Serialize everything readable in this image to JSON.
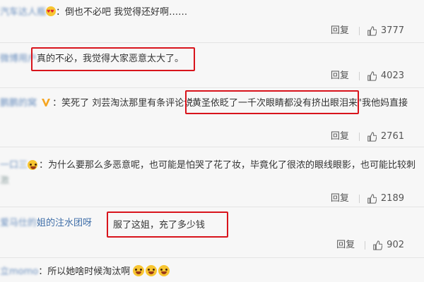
{
  "comments": [
    {
      "user_blurred": "汽车达人瓶",
      "user_suffix": "瓶-",
      "text": "：倒也不必吧 我觉得还好啊……",
      "reply_label": "回复",
      "likes": "3777"
    },
    {
      "user_blurred": "微博用户",
      "text": "真的不必，我觉得大家恶意太大了。",
      "reply_label": "回复",
      "likes": "4023"
    },
    {
      "user_blurred": "鹏鹏的窝",
      "text_before": "：笑死了 刘芸淘汰那里有条评论说",
      "text_highlight": "\"黄圣依眨了一千次眼睛都没有挤出眼泪来\"",
      "text_after": "我他妈直接",
      "reply_label": "回复",
      "likes": "2761"
    },
    {
      "user_blurred": "一口三",
      "text": "：为什么要那么多恶意呢，也可能是怕哭了花了妆，毕竟化了很浓的眼线眼影，也可能比较刺",
      "text_line2_blurred": "激",
      "reply_label": "回复",
      "likes": "2189"
    },
    {
      "user_blurred": "爱马仕的",
      "user_clear": "姐的注水团呀",
      "text": "服了这姐，充了多少钱",
      "reply_label": "回复",
      "likes": "902"
    },
    {
      "user_blurred": "立momo",
      "text": "：所以她啥时候淘汰啊"
    }
  ],
  "icons": {
    "like": "thumbs-up-icon",
    "verified": "verified-v-icon",
    "emoji_love": "heart-eyes-emoji-icon",
    "emoji_laugh": "laughing-emoji-icon"
  },
  "colors": {
    "highlight_border": "#d8141c",
    "username": "#3f6ea8",
    "verified": "#f5a623"
  }
}
